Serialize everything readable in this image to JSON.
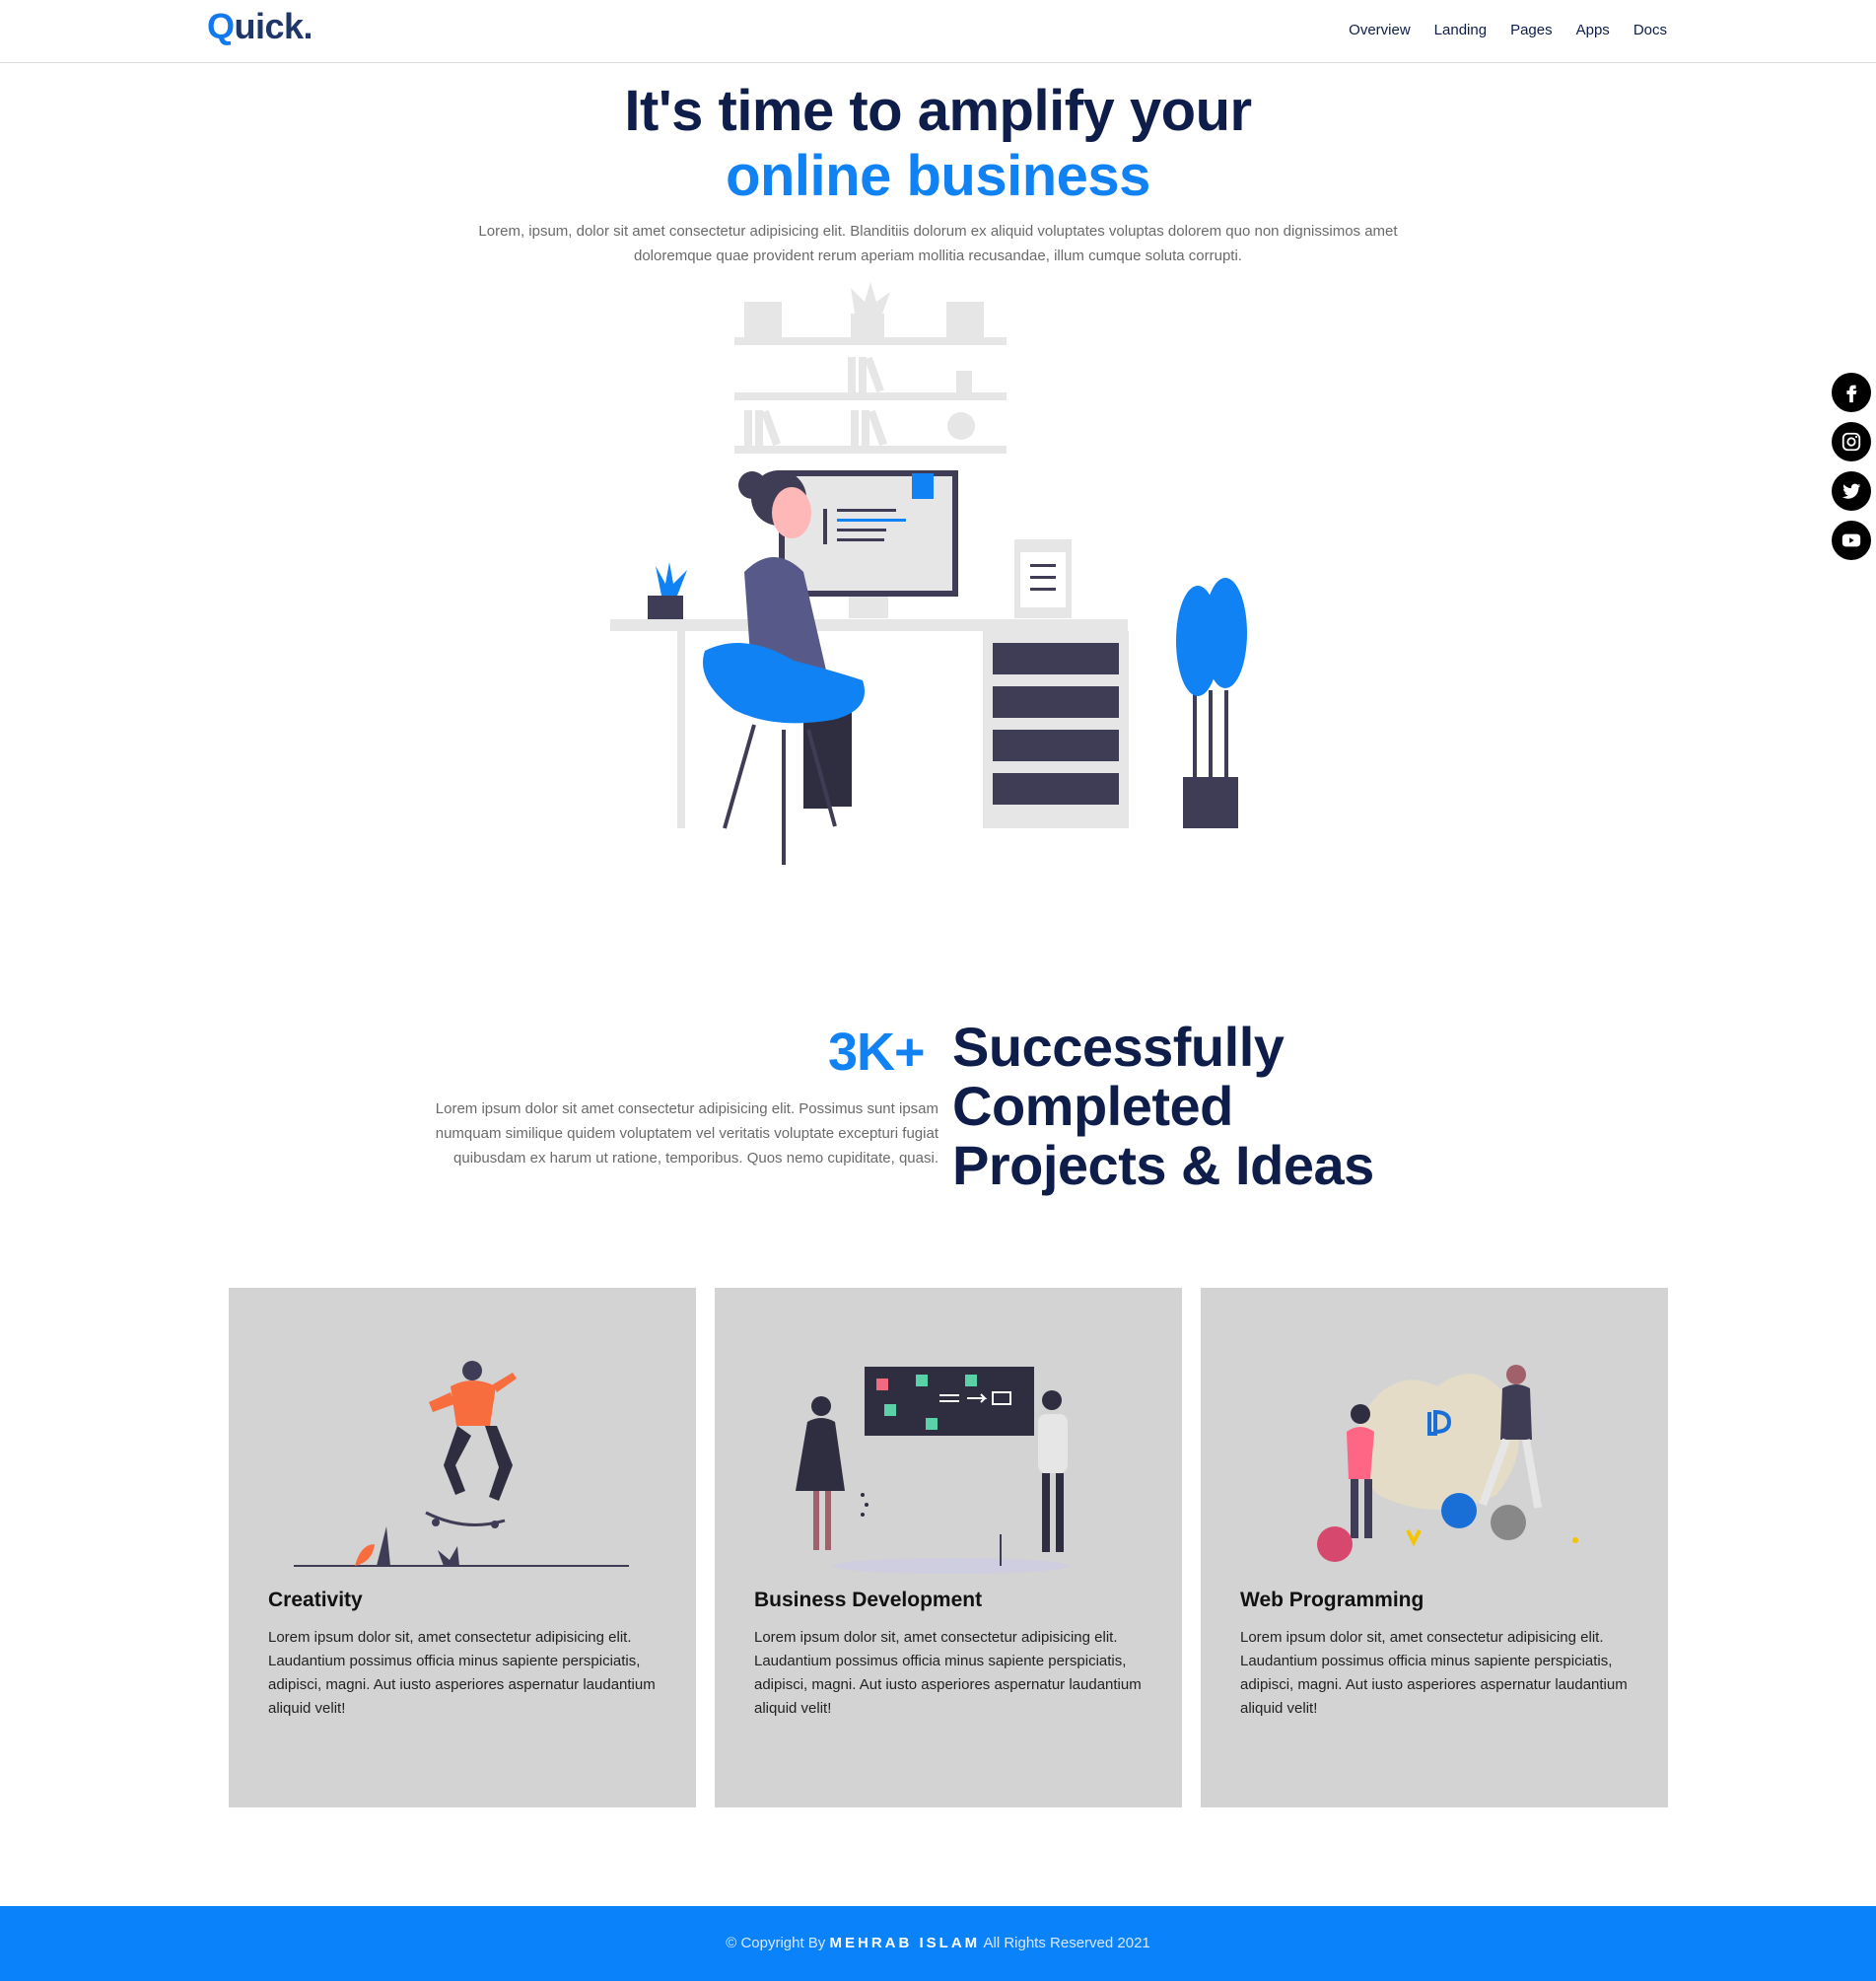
{
  "header": {
    "logo_q": "Q",
    "logo_rest": "uick.",
    "nav": [
      "Overview",
      "Landing",
      "Pages",
      "Apps",
      "Docs"
    ]
  },
  "hero": {
    "title_line1": "It's time to amplify your",
    "title_line2": "online business",
    "description": "Lorem, ipsum, dolor sit amet consectetur adipisicing elit. Blanditiis dolorum ex aliquid voluptates voluptas dolorem quo non dignissimos amet doloremque quae provident rerum aperiam mollitia recusandae, illum cumque soluta corrupti."
  },
  "social": [
    "facebook-icon",
    "instagram-icon",
    "twitter-icon",
    "youtube-icon"
  ],
  "stats": {
    "number": "3K+",
    "heading": "Successfully Completed Projects & Ideas",
    "description": "Lorem ipsum dolor sit amet consectetur adipisicing elit. Possimus sunt ipsam numquam similique quidem voluptatem vel veritatis voluptate excepturi fugiat quibusdam ex harum ut ratione, temporibus. Quos nemo cupiditate, quasi."
  },
  "cards": [
    {
      "title": "Creativity",
      "text": "Lorem ipsum dolor sit, amet consectetur adipisicing elit. Laudantium possimus officia minus sapiente perspiciatis, adipisci, magni. Aut iusto asperiores aspernatur laudantium aliquid velit!"
    },
    {
      "title": "Business Development",
      "text": "Lorem ipsum dolor sit, amet consectetur adipisicing elit. Laudantium possimus officia minus sapiente perspiciatis, adipisci, magni. Aut iusto asperiores aspernatur laudantium aliquid velit!"
    },
    {
      "title": "Web Programming",
      "text": "Lorem ipsum dolor sit, amet consectetur adipisicing elit. Laudantium possimus officia minus sapiente perspiciatis, adipisci, magni. Aut iusto asperiores aspernatur laudantium aliquid velit!"
    }
  ],
  "footer": {
    "prefix": "© Copyright By",
    "author": "MEHRAB ISLAM",
    "suffix": "All Rights Reserved 2021"
  },
  "colors": {
    "primary": "#1082f4",
    "navy": "#0e1d4a",
    "card_bg": "#d3d3d3",
    "footer_bg": "#0a82fa"
  }
}
